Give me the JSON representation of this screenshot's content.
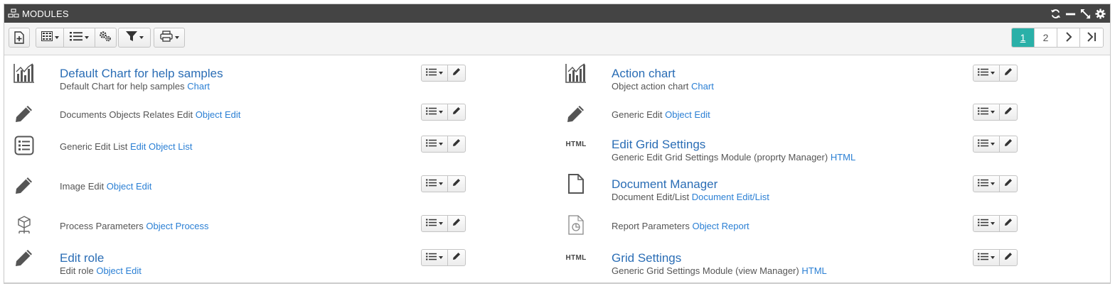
{
  "header": {
    "title": "MODULES",
    "title_icon": "modules-icon",
    "tools": [
      "refresh-icon",
      "minimize-icon",
      "expand-icon",
      "settings-icon"
    ],
    "background": "#444444"
  },
  "toolbar": {
    "buttons": [
      "add-module-icon",
      "grid-view-icon",
      "list-view-icon",
      "gears-icon",
      "filter-icon",
      "print-icon"
    ]
  },
  "pager": {
    "pages": [
      "1",
      "2"
    ],
    "active_page": "1",
    "next_icon": "chevron-right-icon",
    "last_icon": "last-page-icon",
    "active_color": "#2ab0a8"
  },
  "modules": {
    "left": [
      {
        "icon": "bar-chart-icon",
        "title": "Default Chart for help samples",
        "desc": "Default Chart for help samples",
        "link": "Chart"
      },
      {
        "icon": "pencil-icon",
        "title": "",
        "desc": "Documents Objects Relates Edit",
        "link": "Object Edit"
      },
      {
        "icon": "list-icon",
        "title": "",
        "desc": "Generic Edit List",
        "link": "Edit Object List"
      },
      {
        "icon": "pencil-icon",
        "title": "",
        "desc": "Image Edit",
        "link": "Object Edit"
      },
      {
        "icon": "process-icon",
        "title": "",
        "desc": "Process Parameters",
        "link": "Object Process"
      },
      {
        "icon": "pencil-icon",
        "title": "Edit role",
        "desc": "Edit role",
        "link": "Object Edit"
      }
    ],
    "right": [
      {
        "icon": "bar-chart-icon",
        "title": "Action chart",
        "desc": "Object action chart",
        "link": "Chart"
      },
      {
        "icon": "pencil-icon",
        "title": "",
        "desc": "Generic Edit",
        "link": "Object Edit"
      },
      {
        "icon": "html-icon",
        "icon_text": "HTML",
        "title": "Edit Grid Settings",
        "desc": "Generic Edit Grid Settings Module (proprty Manager)",
        "link": "HTML"
      },
      {
        "icon": "document-icon",
        "title": "Document Manager",
        "desc": "Document Edit/List",
        "link": "Document Edit/List"
      },
      {
        "icon": "report-icon",
        "title": "",
        "desc": "Report Parameters",
        "link": "Object Report"
      },
      {
        "icon": "html-icon",
        "icon_text": "HTML",
        "title": "Grid Settings",
        "desc": "Generic Grid Settings Module (view Manager)",
        "link": "HTML"
      }
    ]
  },
  "colors": {
    "link": "#2a7fd4",
    "title": "#2a6db5"
  }
}
